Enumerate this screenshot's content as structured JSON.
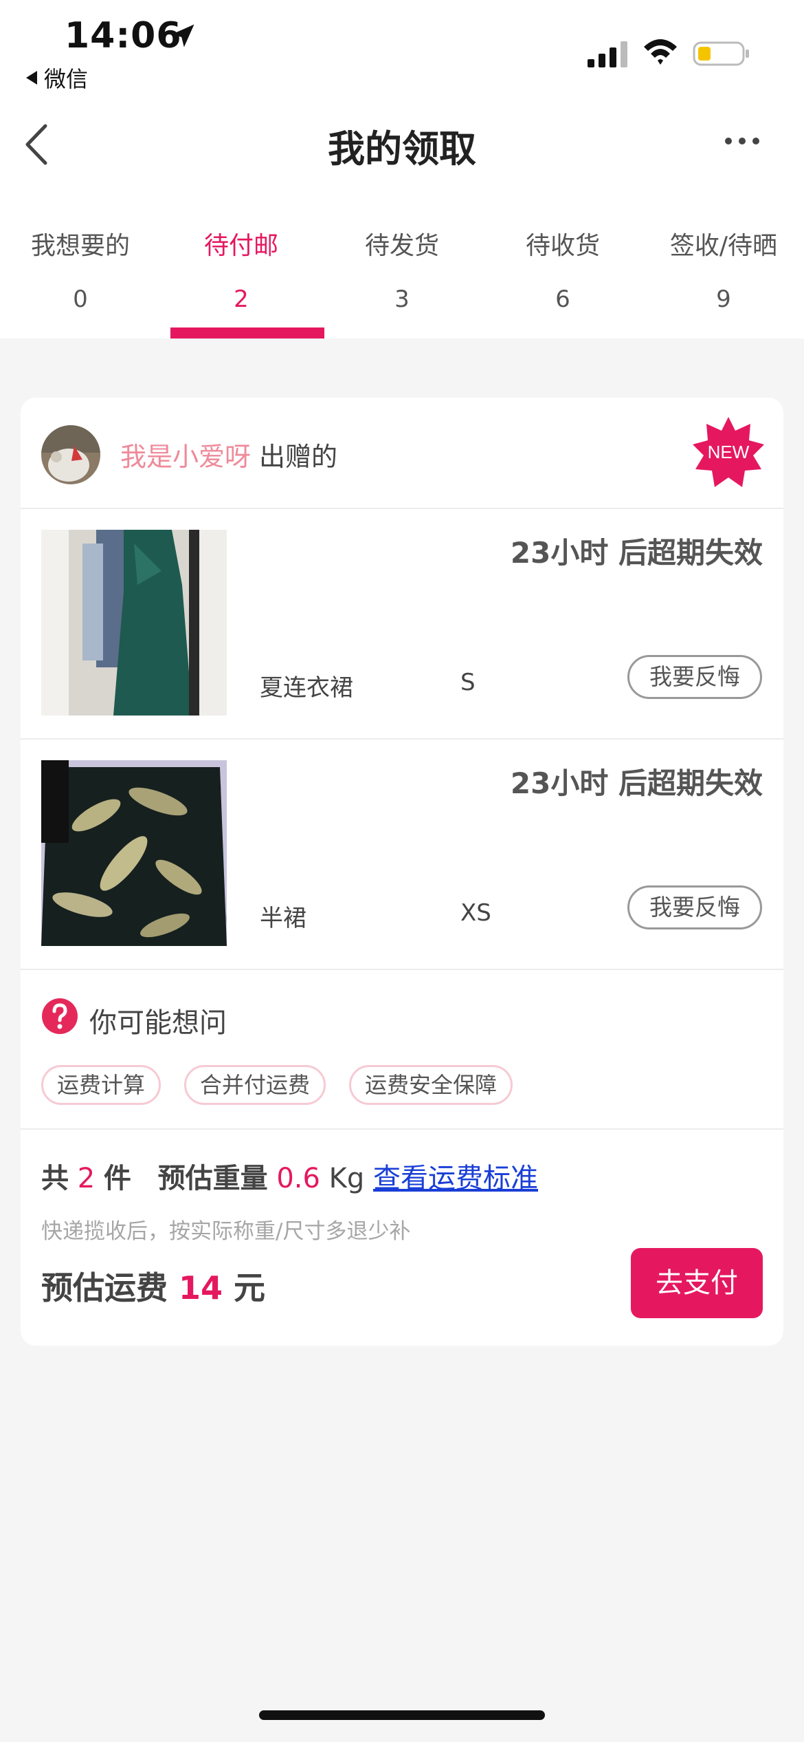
{
  "status_bar": {
    "time": "14:06",
    "back_app_label": "微信",
    "battery_color": "#f5c400"
  },
  "nav": {
    "title": "我的领取"
  },
  "tabs": [
    {
      "label": "我想要的",
      "count": "0",
      "active": false
    },
    {
      "label": "待付邮",
      "count": "2",
      "active": true
    },
    {
      "label": "待发货",
      "count": "3",
      "active": false
    },
    {
      "label": "待收货",
      "count": "6",
      "active": false
    },
    {
      "label": "签收/待晒",
      "count": "9",
      "active": false
    }
  ],
  "card": {
    "giver_name": "我是小爱呀",
    "giver_suffix": "出赠的",
    "new_badge": "NEW",
    "items": [
      {
        "expire": "23小时 后超期失效",
        "name": "夏连衣裙",
        "size": "S",
        "regret_label": "我要反悔"
      },
      {
        "expire": "23小时 后超期失效",
        "name": "半裙",
        "size": "XS",
        "regret_label": "我要反悔"
      }
    ],
    "faq": {
      "title": "你可能想问",
      "tags": [
        "运费计算",
        "合并付运费",
        "运费安全保障"
      ]
    },
    "summary": {
      "count_prefix": "共",
      "count": "2",
      "count_suffix": "件",
      "weight_label": "预估重量",
      "weight_value": "0.6",
      "weight_unit": "Kg",
      "link": "查看运费标准",
      "note": "快递揽收后，按实际称重/尺寸多退少补",
      "fee_label": "预估运费",
      "fee_value": "14",
      "fee_unit": "元",
      "pay_label": "去支付"
    }
  },
  "colors": {
    "accent": "#e5185f",
    "giver_name": "#ef8a9a",
    "link": "#1a3fd6"
  }
}
